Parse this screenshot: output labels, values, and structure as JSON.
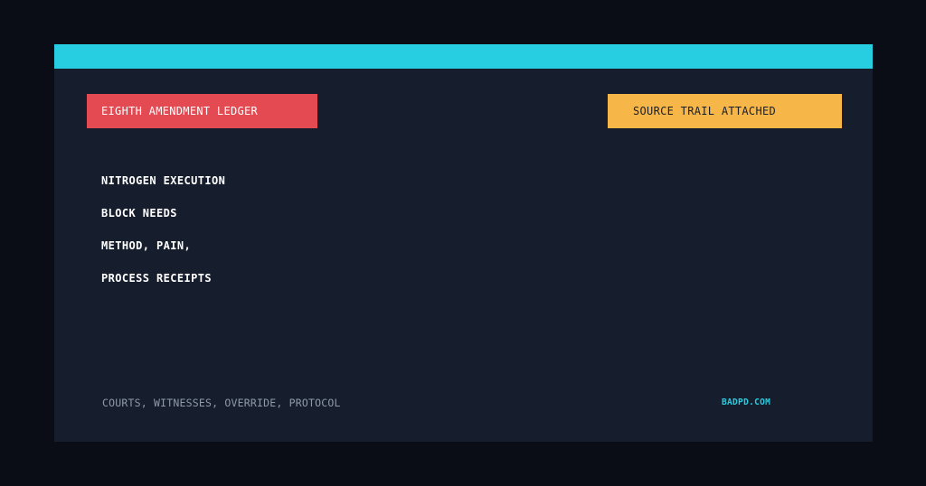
{
  "badges": {
    "left_label": "EIGHTH AMENDMENT LEDGER",
    "right_label": "SOURCE TRAIL ATTACHED"
  },
  "headline": {
    "lines": [
      "NITROGEN EXECUTION",
      "BLOCK NEEDS",
      "METHOD, PAIN,",
      "PROCESS RECEIPTS"
    ]
  },
  "footer": {
    "tags": "COURTS, WITNESSES, OVERRIDE, PROTOCOL",
    "site": "BADPD.COM"
  },
  "colors": {
    "background": "#0a0d15",
    "card": "#161e2d",
    "accent_bar": "#27cde0",
    "left_badge": "#e34a52",
    "right_badge": "#f6b748",
    "site_text": "#27cde0"
  }
}
